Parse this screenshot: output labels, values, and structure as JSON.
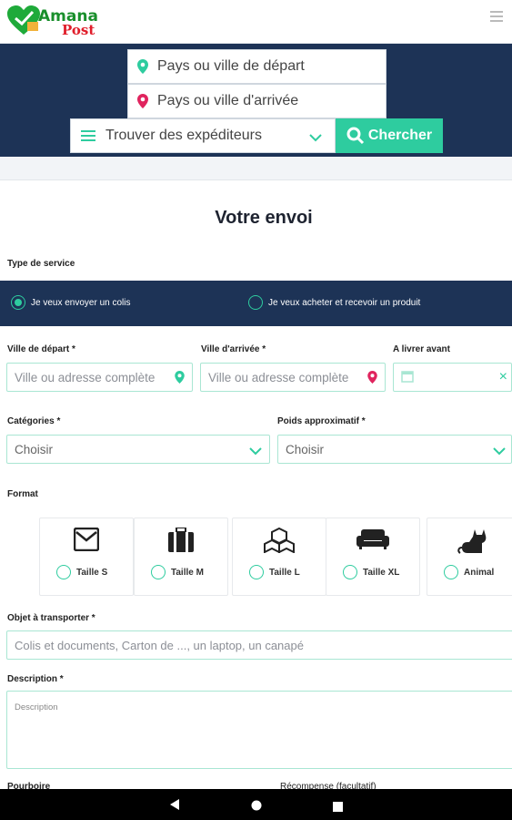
{
  "app": {
    "logo_line1": "Amana",
    "logo_line2": "Post"
  },
  "search": {
    "depart_placeholder": "Pays ou ville de départ",
    "arrive_placeholder": "Pays ou ville d'arrivée",
    "mode_label": "Trouver des expéditeurs",
    "search_button": "Chercher"
  },
  "form": {
    "title": "Votre envoi",
    "service_type_label": "Type de service",
    "service_options": [
      {
        "label": "Je veux envoyer un colis",
        "selected": true
      },
      {
        "label": "Je veux acheter et recevoir un produit",
        "selected": false
      }
    ],
    "depart_label": "Ville de départ *",
    "depart_placeholder": "Ville ou adresse complète",
    "arrive_label": "Ville d'arrivée *",
    "arrive_placeholder": "Ville ou adresse complète",
    "deliver_before_label": "A livrer avant",
    "categories_label": "Catégories *",
    "categories_value": "Choisir",
    "weight_label": "Poids approximatif *",
    "weight_value": "Choisir",
    "format_label": "Format",
    "formats": [
      {
        "label": "Taille S",
        "icon": "envelope-icon"
      },
      {
        "label": "Taille M",
        "icon": "suitcase-icon"
      },
      {
        "label": "Taille L",
        "icon": "boxes-icon"
      },
      {
        "label": "Taille XL",
        "icon": "sofa-icon"
      },
      {
        "label": "Animal",
        "icon": "cat-icon"
      }
    ],
    "object_label": "Objet à transporter *",
    "object_placeholder": "Colis et documents, Carton de ..., un laptop, un canapé",
    "description_label": "Description *",
    "description_placeholder": "Description",
    "tip_label": "Pourboire",
    "reward_label": "Récompense (facultatif)"
  },
  "colors": {
    "navy": "#1d3356",
    "accent": "#2ecc9f",
    "pin_depart": "#2ecc9f",
    "pin_arrive": "#e0245e"
  }
}
